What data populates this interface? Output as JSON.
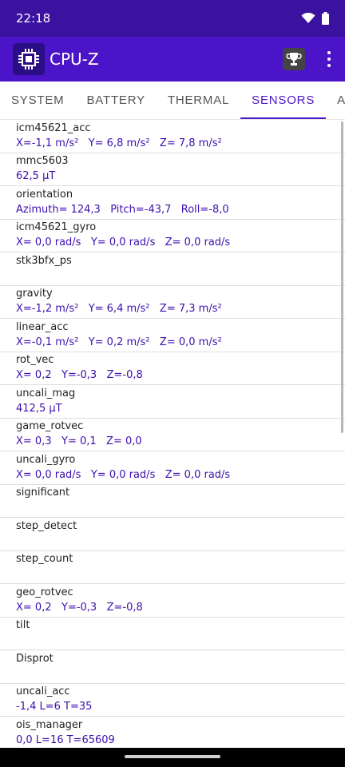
{
  "status": {
    "time": "22:18"
  },
  "app": {
    "title": "CPU-Z"
  },
  "tabs": [
    {
      "label": "SYSTEM"
    },
    {
      "label": "BATTERY"
    },
    {
      "label": "THERMAL"
    },
    {
      "label": "SENSORS"
    },
    {
      "label": "ABOUT"
    }
  ],
  "sensors": [
    {
      "name": "icm45621_acc",
      "value": "X=-1,1 m/s²   Y= 6,8 m/s²   Z= 7,8 m/s²"
    },
    {
      "name": "mmc5603",
      "value": "62,5 µT"
    },
    {
      "name": "orientation",
      "value": "Azimuth= 124,3   Pitch=-43,7   Roll=-8,0"
    },
    {
      "name": "icm45621_gyro",
      "value": "X= 0,0 rad/s   Y= 0,0 rad/s   Z= 0,0 rad/s"
    },
    {
      "name": "stk3bfx_ps",
      "value": ""
    },
    {
      "name": "gravity",
      "value": "X=-1,2 m/s²   Y= 6,4 m/s²   Z= 7,3 m/s²"
    },
    {
      "name": "linear_acc",
      "value": "X=-0,1 m/s²   Y= 0,2 m/s²   Z= 0,0 m/s²"
    },
    {
      "name": "rot_vec",
      "value": "X= 0,2   Y=-0,3   Z=-0,8"
    },
    {
      "name": "uncali_mag",
      "value": "412,5 µT"
    },
    {
      "name": "game_rotvec",
      "value": "X= 0,3   Y= 0,1   Z= 0,0"
    },
    {
      "name": "uncali_gyro",
      "value": "X= 0,0 rad/s   Y= 0,0 rad/s   Z= 0,0 rad/s"
    },
    {
      "name": "significant",
      "value": ""
    },
    {
      "name": "step_detect",
      "value": ""
    },
    {
      "name": "step_count",
      "value": ""
    },
    {
      "name": "geo_rotvec",
      "value": "X= 0,2   Y=-0,3   Z=-0,8"
    },
    {
      "name": "tilt",
      "value": ""
    },
    {
      "name": "Disprot",
      "value": ""
    },
    {
      "name": "uncali_acc",
      "value": "-1,4 L=6 T=35"
    },
    {
      "name": "ois_manager",
      "value": "0,0 L=16 T=65609"
    }
  ]
}
